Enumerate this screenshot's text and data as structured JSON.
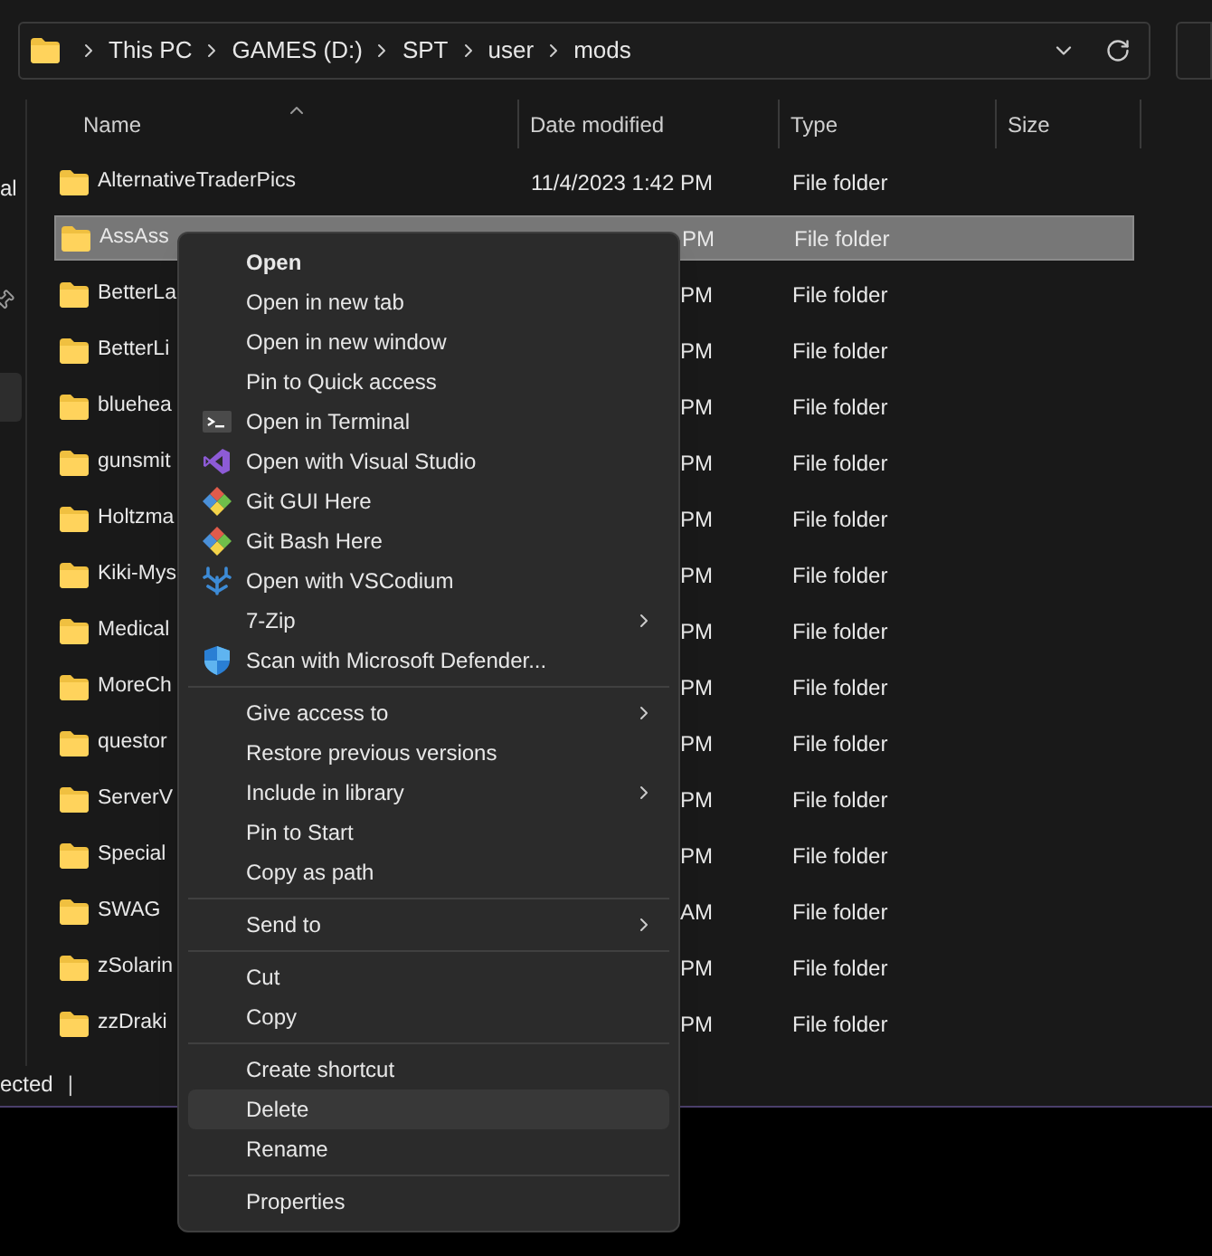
{
  "address_bar": {
    "crumbs": [
      "This PC",
      "GAMES (D:)",
      "SPT",
      "user",
      "mods"
    ]
  },
  "sidebar": {
    "label": "al"
  },
  "table": {
    "columns": [
      "Name",
      "Date modified",
      "Type",
      "Size"
    ],
    "rows": [
      {
        "name": "AlternativeTraderPics",
        "date": "11/4/2023 1:42 PM",
        "type": "File folder",
        "selected": false
      },
      {
        "name": "AssAss",
        "date": "PM",
        "type": "File folder",
        "selected": true
      },
      {
        "name": "BetterLa",
        "date": "PM",
        "type": "File folder",
        "selected": false
      },
      {
        "name": "BetterLi",
        "date": "PM",
        "type": "File folder",
        "selected": false
      },
      {
        "name": "bluehea",
        "date": "PM",
        "type": "File folder",
        "selected": false
      },
      {
        "name": "gunsmit",
        "date": "PM",
        "type": "File folder",
        "selected": false
      },
      {
        "name": "Holtzma",
        "date": "PM",
        "type": "File folder",
        "selected": false
      },
      {
        "name": "Kiki-Mys",
        "date": "PM",
        "type": "File folder",
        "selected": false
      },
      {
        "name": "Medical",
        "date": "PM",
        "type": "File folder",
        "selected": false
      },
      {
        "name": "MoreCh",
        "date": "PM",
        "type": "File folder",
        "selected": false
      },
      {
        "name": "questor",
        "date": "PM",
        "type": "File folder",
        "selected": false
      },
      {
        "name": "ServerV",
        "date": "PM",
        "type": "File folder",
        "selected": false
      },
      {
        "name": "Special",
        "date": "PM",
        "type": "File folder",
        "selected": false
      },
      {
        "name": "SWAG",
        "date": "AM",
        "type": "File folder",
        "selected": false
      },
      {
        "name": "zSolarin",
        "date": "PM",
        "type": "File folder",
        "selected": false
      },
      {
        "name": "zzDraki",
        "date": "PM",
        "type": "File folder",
        "selected": false
      }
    ]
  },
  "status_bar": {
    "text": "ected",
    "separator": "|"
  },
  "context_menu": {
    "groups": [
      [
        {
          "label": "Open",
          "default": true,
          "submenu": false,
          "selected": false
        },
        {
          "label": "Open in new tab",
          "default": false,
          "submenu": false,
          "selected": false
        },
        {
          "label": "Open in new window",
          "default": false,
          "submenu": false,
          "selected": false
        },
        {
          "label": "Pin to Quick access",
          "default": false,
          "submenu": false,
          "selected": false
        },
        {
          "label": "Open in Terminal",
          "default": false,
          "submenu": false,
          "selected": false
        },
        {
          "label": "Open with Visual Studio",
          "default": false,
          "submenu": false,
          "selected": false
        },
        {
          "label": "Git GUI Here",
          "default": false,
          "submenu": false,
          "selected": false
        },
        {
          "label": "Git Bash Here",
          "default": false,
          "submenu": false,
          "selected": false
        },
        {
          "label": "Open with VSCodium",
          "default": false,
          "submenu": false,
          "selected": false
        },
        {
          "label": "7-Zip",
          "default": false,
          "submenu": true,
          "selected": false
        },
        {
          "label": "Scan with Microsoft Defender...",
          "default": false,
          "submenu": false,
          "selected": false
        }
      ],
      [
        {
          "label": "Give access to",
          "default": false,
          "submenu": true,
          "selected": false
        },
        {
          "label": "Restore previous versions",
          "default": false,
          "submenu": false,
          "selected": false
        },
        {
          "label": "Include in library",
          "default": false,
          "submenu": true,
          "selected": false
        },
        {
          "label": "Pin to Start",
          "default": false,
          "submenu": false,
          "selected": false
        },
        {
          "label": "Copy as path",
          "default": false,
          "submenu": false,
          "selected": false
        }
      ],
      [
        {
          "label": "Send to",
          "default": false,
          "submenu": true,
          "selected": false
        }
      ],
      [
        {
          "label": "Cut",
          "default": false,
          "submenu": false,
          "selected": false
        },
        {
          "label": "Copy",
          "default": false,
          "submenu": false,
          "selected": false
        }
      ],
      [
        {
          "label": "Create shortcut",
          "default": false,
          "submenu": false,
          "selected": false
        },
        {
          "label": "Delete",
          "default": false,
          "submenu": false,
          "selected": true
        },
        {
          "label": "Rename",
          "default": false,
          "submenu": false,
          "selected": false
        }
      ],
      [
        {
          "label": "Properties",
          "default": false,
          "submenu": false,
          "selected": false
        }
      ]
    ]
  }
}
